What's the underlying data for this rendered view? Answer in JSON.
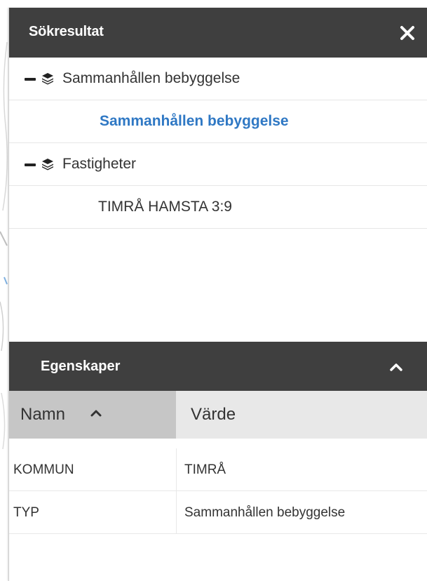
{
  "search_results": {
    "title": "Sökresultat",
    "close_icon": "close-icon",
    "groups": [
      {
        "label": "Sammanhållen bebyggelse",
        "icon": "layers-icon",
        "items": [
          "Sammanhållen bebyggelse"
        ]
      },
      {
        "label": "Fastigheter",
        "icon": "layers-icon",
        "items": [
          "TIMRÅ HAMSTA 3:9"
        ]
      }
    ]
  },
  "properties": {
    "title": "Egenskaper",
    "collapse_icon": "chevron-up-icon",
    "columns": {
      "name": "Namn",
      "value": "Värde"
    },
    "rows": [
      {
        "name": "KOMMUN",
        "value": "TIMRÅ"
      },
      {
        "name": "TYP",
        "value": "Sammanhållen bebyggelse"
      }
    ]
  },
  "colors": {
    "header_bg": "#3f3f3f",
    "link": "#2f78c4",
    "sorted_column_bg": "#c6c6c6"
  }
}
